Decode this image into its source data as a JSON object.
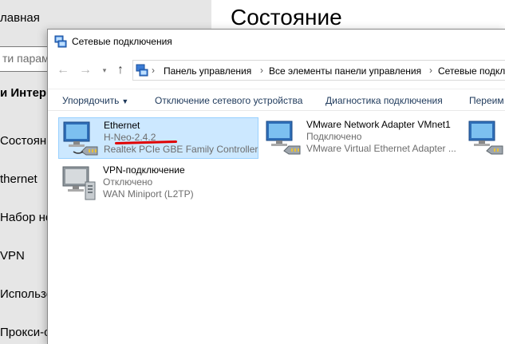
{
  "settings": {
    "title": "Состояние",
    "search_placeholder": "ти парам",
    "sidebar": [
      {
        "label": "лавная",
        "bold": false
      },
      {
        "label": "и Интерн",
        "bold": true
      },
      {
        "label": "Состояние",
        "bold": false
      },
      {
        "label": "thernet",
        "bold": false
      },
      {
        "label": "Набор но",
        "bold": false
      },
      {
        "label": "VPN",
        "bold": false
      },
      {
        "label": "Использо",
        "bold": false
      },
      {
        "label": "Прокси-се",
        "bold": false
      }
    ]
  },
  "netwin": {
    "title": "Сетевые подключения",
    "address": {
      "crumbs": [
        "Панель управления",
        "Все элементы панели управления",
        "Сетевые подкл"
      ]
    },
    "nav": {
      "back": "←",
      "forward": "→",
      "up": "↑"
    },
    "toolbar": {
      "organize": "Упорядочить",
      "disable": "Отключение сетевого устройства",
      "diagnose": "Диагностика подключения",
      "rename": "Переим"
    },
    "connections": [
      {
        "name": "Ethernet",
        "status": "H-Neo-2.4.2",
        "device": "Realtek PCIe GBE Family Controller",
        "selected": true,
        "icon": "network-adapter-icon"
      },
      {
        "name": "VMware Network Adapter VMnet1",
        "status": "Подключено",
        "device": "VMware Virtual Ethernet Adapter ...",
        "selected": false,
        "icon": "network-adapter-icon"
      },
      {
        "name": "",
        "status": "",
        "device": "",
        "selected": false,
        "icon": "network-adapter-icon"
      },
      {
        "name": "VPN-подключение",
        "status": "Отключено",
        "device": "WAN Miniport (L2TP)",
        "selected": false,
        "icon": "vpn-adapter-icon"
      }
    ]
  },
  "colors": {
    "selection_bg": "#cce8ff",
    "selection_border": "#99d1ff",
    "annotation_red": "#e00000",
    "toolbar_text": "#1e395b"
  }
}
